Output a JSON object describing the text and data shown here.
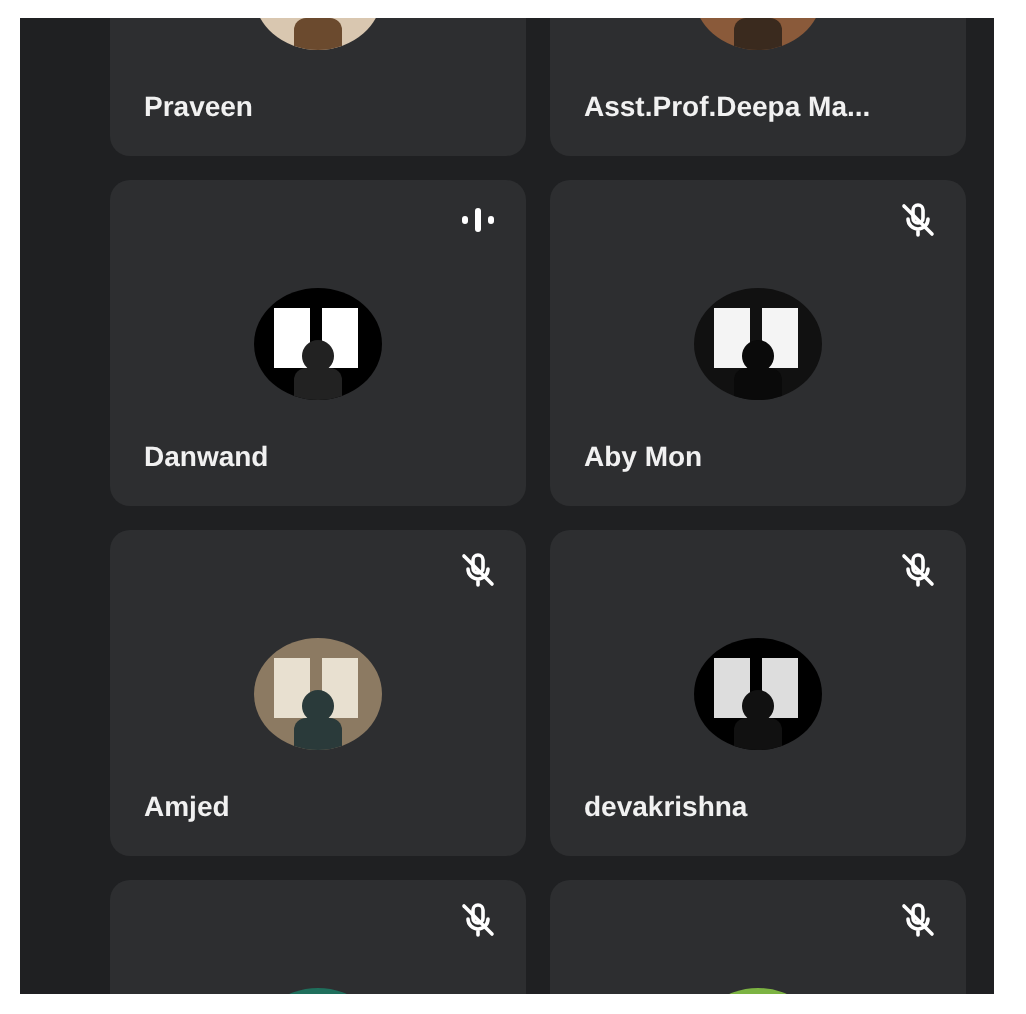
{
  "tiles": [
    {
      "name": "Praveen"
    },
    {
      "name": "Asst.Prof.Deepa Ma..."
    },
    {
      "name": "Danwand",
      "muted": false
    },
    {
      "name": "Aby Mon",
      "muted": true
    },
    {
      "name": "Amjed",
      "muted": true
    },
    {
      "name": "devakrishna",
      "muted": true
    },
    {
      "muted": true
    },
    {
      "muted": true
    }
  ]
}
